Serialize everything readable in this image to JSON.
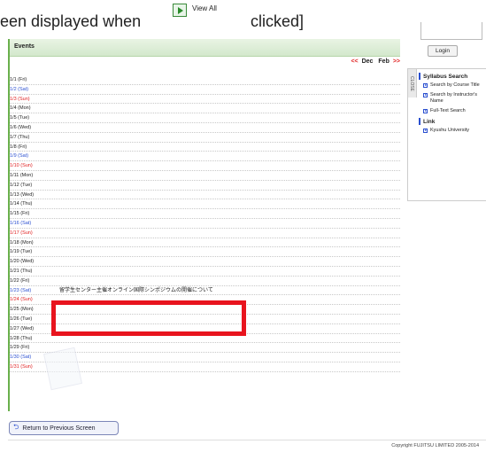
{
  "caption": {
    "before": "een displayed when",
    "view_all": "View All",
    "after": "clicked]"
  },
  "events": {
    "header": "Events",
    "nav": {
      "prev_arrow": "<<",
      "prev": "Dec",
      "next": "Feb",
      "next_arrow": ">>"
    },
    "days": [
      {
        "label": "1/1 (Fri)",
        "kind": "weekday"
      },
      {
        "label": "1/2 (Sat)",
        "kind": "sat"
      },
      {
        "label": "1/3 (Sun)",
        "kind": "sun"
      },
      {
        "label": "1/4 (Mon)",
        "kind": "weekday"
      },
      {
        "label": "1/5 (Tue)",
        "kind": "weekday"
      },
      {
        "label": "1/6 (Wed)",
        "kind": "weekday"
      },
      {
        "label": "1/7 (Thu)",
        "kind": "weekday"
      },
      {
        "label": "1/8 (Fri)",
        "kind": "weekday"
      },
      {
        "label": "1/9 (Sat)",
        "kind": "sat"
      },
      {
        "label": "1/10 (Sun)",
        "kind": "sun"
      },
      {
        "label": "1/11 (Mon)",
        "kind": "weekday"
      },
      {
        "label": "1/12 (Tue)",
        "kind": "weekday"
      },
      {
        "label": "1/13 (Wed)",
        "kind": "weekday"
      },
      {
        "label": "1/14 (Thu)",
        "kind": "weekday"
      },
      {
        "label": "1/15 (Fri)",
        "kind": "weekday"
      },
      {
        "label": "1/16 (Sat)",
        "kind": "sat"
      },
      {
        "label": "1/17 (Sun)",
        "kind": "sun"
      },
      {
        "label": "1/18 (Mon)",
        "kind": "weekday"
      },
      {
        "label": "1/19 (Tue)",
        "kind": "weekday"
      },
      {
        "label": "1/20 (Wed)",
        "kind": "weekday"
      },
      {
        "label": "1/21 (Thu)",
        "kind": "weekday"
      },
      {
        "label": "1/22 (Fri)",
        "kind": "weekday"
      },
      {
        "label": "1/23 (Sat)",
        "kind": "sat",
        "event": "留学生センター主催オンライン国際シンポジウムの開催について"
      },
      {
        "label": "1/24 (Sun)",
        "kind": "sun"
      },
      {
        "label": "1/25 (Mon)",
        "kind": "weekday"
      },
      {
        "label": "1/26 (Tue)",
        "kind": "weekday"
      },
      {
        "label": "1/27 (Wed)",
        "kind": "weekday"
      },
      {
        "label": "1/28 (Thu)",
        "kind": "weekday"
      },
      {
        "label": "1/29 (Fri)",
        "kind": "weekday"
      },
      {
        "label": "1/30 (Sat)",
        "kind": "sat"
      },
      {
        "label": "1/31 (Sun)",
        "kind": "sun"
      }
    ]
  },
  "return_button": "Return to Previous Screen",
  "copyright": "Copyright FUJITSU LIMITED 2005-2014",
  "sidebar": {
    "login": "Login",
    "close_tab": "CLOSE",
    "syllabus_heading": "Syllabus Search",
    "syllabus_links": [
      "Search by Course Title",
      "Search by Instructor's Name",
      "Full-Text Search"
    ],
    "link_heading": "Link",
    "link_items": [
      "Kyushu University"
    ]
  },
  "colors": {
    "saturday": "#2a4fd0",
    "sunday": "#e02020",
    "highlight": "#e8141e",
    "accent_green": "#6ab04c"
  }
}
